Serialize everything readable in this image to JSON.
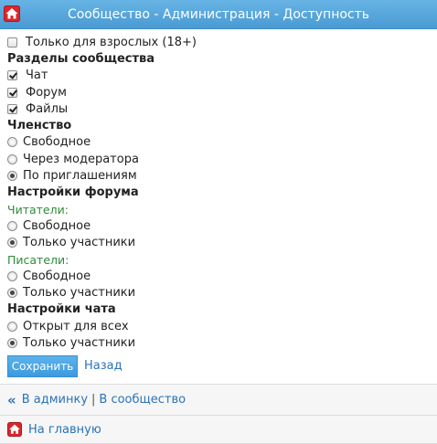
{
  "header": {
    "title": "Сообщество - Администрация - Доступность",
    "icon": "home-icon"
  },
  "form": {
    "adult_only": {
      "label": "Только для взрослых (18+)",
      "checked": false
    },
    "sections": {
      "title": "Разделы сообщества",
      "items": [
        {
          "label": "Чат",
          "checked": true
        },
        {
          "label": "Форум",
          "checked": true
        },
        {
          "label": "Файлы",
          "checked": true
        }
      ]
    },
    "membership": {
      "title": "Членство",
      "options": [
        {
          "label": "Свободное",
          "checked": false
        },
        {
          "label": "Через модератора",
          "checked": false
        },
        {
          "label": "По приглашениям",
          "checked": true
        }
      ]
    },
    "forum_settings": {
      "title": "Настройки форума",
      "readers": {
        "label": "Читатели:",
        "options": [
          {
            "label": "Свободное",
            "checked": false
          },
          {
            "label": "Только участники",
            "checked": true
          }
        ]
      },
      "writers": {
        "label": "Писатели:",
        "options": [
          {
            "label": "Свободное",
            "checked": false
          },
          {
            "label": "Только участники",
            "checked": true
          }
        ]
      }
    },
    "chat_settings": {
      "title": "Настройки чата",
      "options": [
        {
          "label": "Открыт для всех",
          "checked": false
        },
        {
          "label": "Только участники",
          "checked": true
        }
      ]
    },
    "save_label": "Сохранить",
    "back_label": "Назад"
  },
  "footer": {
    "admin_link": "В админку",
    "separator": "|",
    "community_link": "В сообщество",
    "home_link": "На главную"
  },
  "colors": {
    "header_bg": "#5aa9df",
    "link": "#2b73b7",
    "sublabel": "#2e8b3a",
    "home_icon": "#d9262c"
  }
}
